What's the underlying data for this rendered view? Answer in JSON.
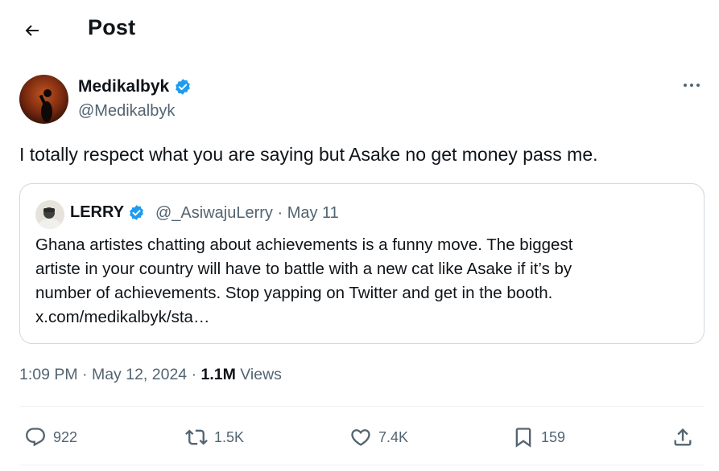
{
  "header": {
    "title": "Post",
    "back_icon": "arrow-left-icon"
  },
  "author": {
    "name": "Medikalbyk",
    "handle": "@Medikalbyk",
    "verified": true,
    "verified_color": "#1d9bf0"
  },
  "tweet": {
    "text": "I totally respect what you are saying but Asake no get money pass me."
  },
  "quoted_post": {
    "name": "LERRY",
    "handle": "@_AsiwajuLerry",
    "date": "May 11",
    "separator": "·",
    "lines": [
      "Ghana artistes chatting about achievements is a funny move. The biggest",
      "artiste in your country will have to battle with a new cat like Asake if it’s by",
      "number of achievements. Stop yapping on Twitter and get in the booth.",
      "x.com/medikalbyk/sta…"
    ]
  },
  "meta": {
    "time": "1:09 PM",
    "date": "May 12, 2024",
    "views_count": "1.1M",
    "views_label": "Views",
    "separator": "·"
  },
  "actions": {
    "replies": "922",
    "reposts": "1.5K",
    "likes": "7.4K",
    "bookmarks": "159"
  },
  "colors": {
    "text": "#0f1419",
    "secondary": "#536471",
    "border": "#cfd9de",
    "accent": "#1d9bf0"
  }
}
